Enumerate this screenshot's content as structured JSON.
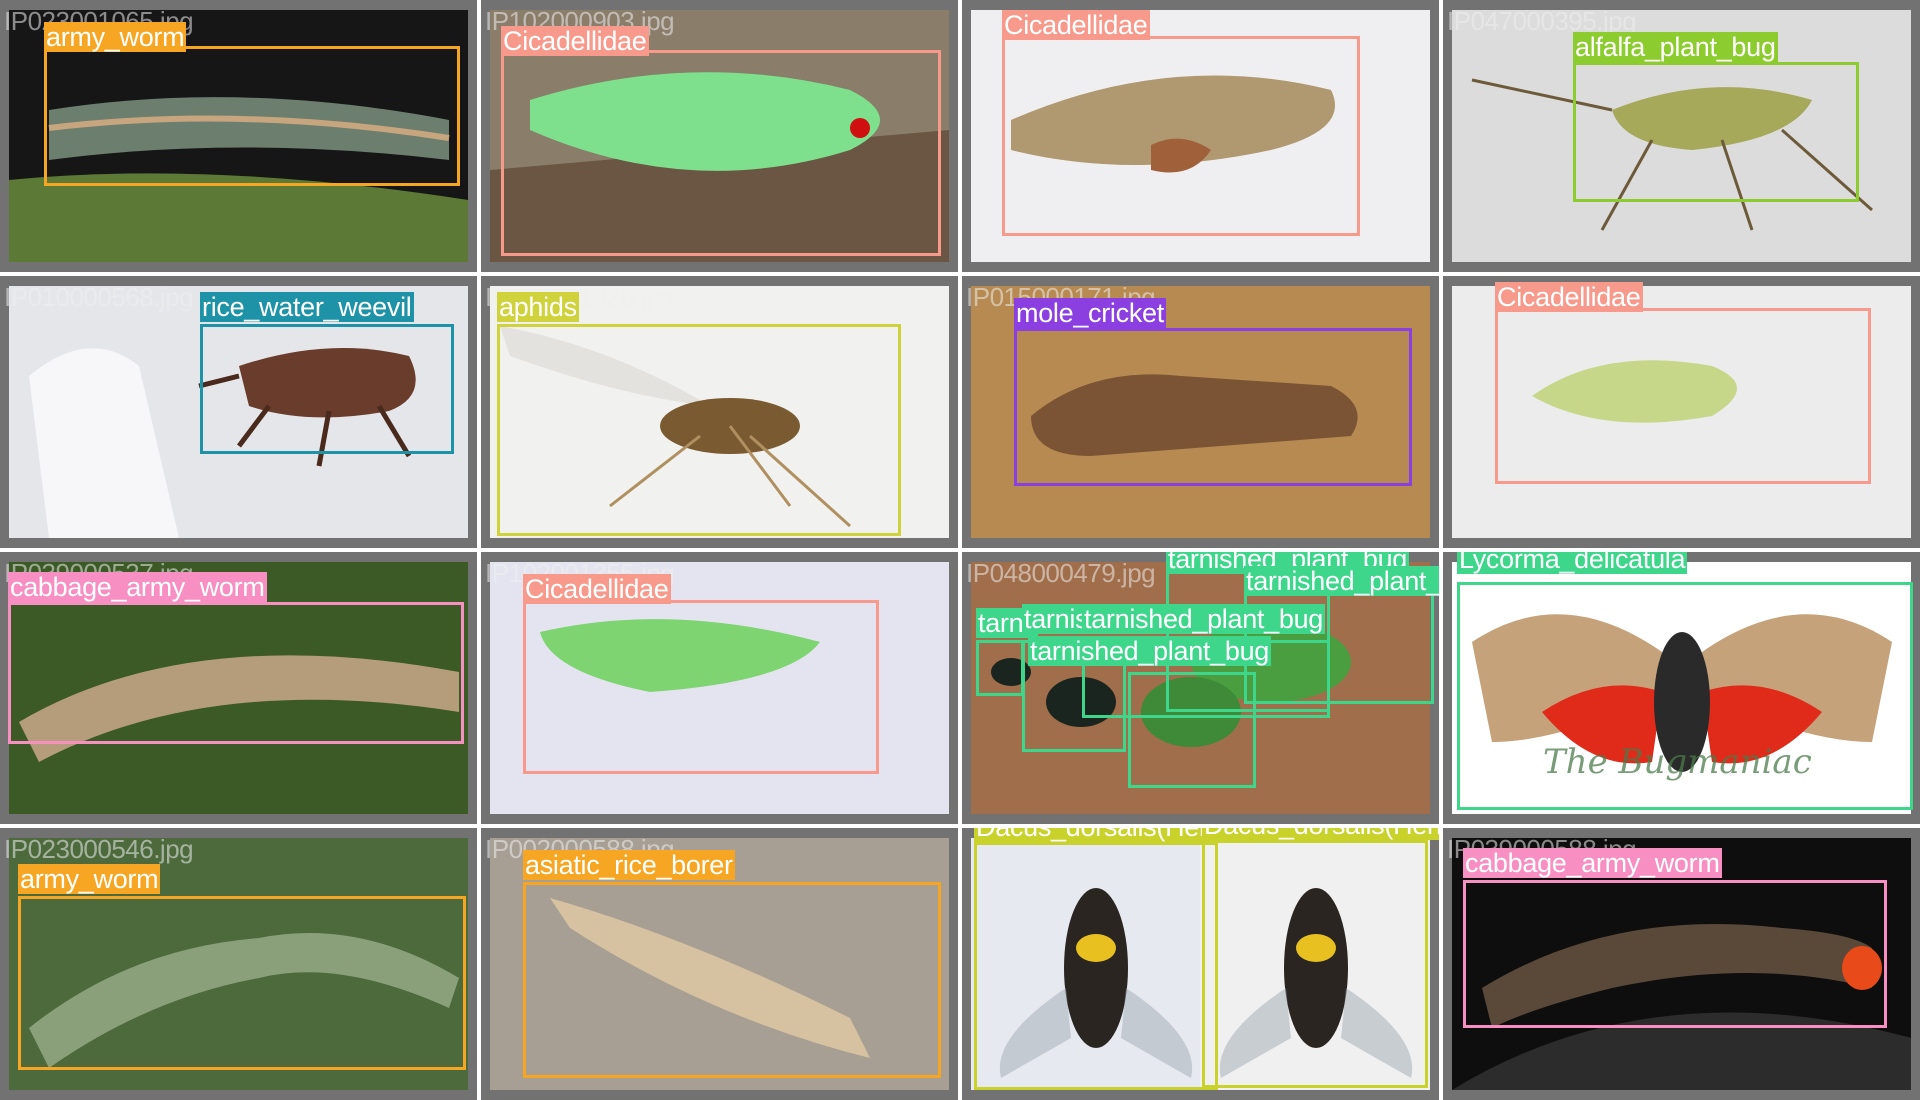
{
  "palette": {
    "army_worm": "#f6a623",
    "Cicadellidae": "#f79a8c",
    "alfalfa_plant_bug": "#8ccc2e",
    "rice_water_weevil": "#1e93a8",
    "aphids": "#cfd23a",
    "mole_cricket": "#8b3fe0",
    "cabbage_army_worm": "#f78fc2",
    "tarnished_plant_bug": "#3dd68a",
    "Lycorma_delicatula": "#3dd68a",
    "asiatic_rice_borer": "#f6a623",
    "Dacus_dorsalis(Hendel)": "#c9d22a"
  },
  "tiles": [
    {
      "filename": "IP023001065.jpg",
      "labels": [
        "army_worm"
      ]
    },
    {
      "filename": "IP102000903.jpg",
      "labels": [
        "Cicadellidae"
      ]
    },
    {
      "filename": "",
      "labels": [
        "Cicadellidae"
      ]
    },
    {
      "filename": "IP047000395.jpg",
      "labels": [
        "alfalfa_plant_bug"
      ]
    },
    {
      "filename": "IP010000568.jpg",
      "labels": [
        "rice_water_weevil"
      ]
    },
    {
      "filename": "IP021001926.jpg",
      "labels": [
        "aphids"
      ]
    },
    {
      "filename": "IP015000171.jpg",
      "labels": [
        "mole_cricket"
      ]
    },
    {
      "filename": "",
      "labels": [
        "Cicadellidae"
      ]
    },
    {
      "filename": "IP039000537.jpg",
      "labels": [
        "cabbage_army_worm"
      ]
    },
    {
      "filename": "IP102001355.jpg",
      "labels": [
        "Cicadellidae"
      ]
    },
    {
      "filename": "IP048000479.jpg",
      "labels": [
        "tarnished_plant_bug",
        "tarnished_plant_bug",
        "tarnished_plant_bug",
        "tarnished_plant_bug",
        "tarnished_plant_bug",
        "tarnished_plant_bug"
      ]
    },
    {
      "filename": "",
      "labels": [
        "Lycorma_delicatula"
      ],
      "watermark": "The Bugmaniac"
    },
    {
      "filename": "IP023000546.jpg",
      "labels": [
        "army_worm"
      ]
    },
    {
      "filename": "IP002000588.jpg",
      "labels": [
        "asiatic_rice_borer"
      ]
    },
    {
      "filename": "",
      "labels": [
        "Dacus_dorsalis(Hendel)",
        "Dacus_dorsalis(Hendel)"
      ]
    },
    {
      "filename": "IP039000588.jpg",
      "labels": [
        "cabbage_army_worm"
      ]
    }
  ]
}
